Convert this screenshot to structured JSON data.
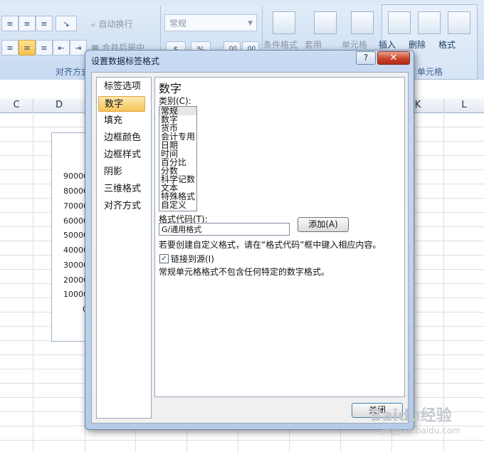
{
  "ribbon": {
    "wrap_text": "自动换行",
    "merge_center": "合并后居中",
    "number_format": "常规",
    "alignment_group": "对齐方式",
    "conditional_format": "条件格式",
    "table_format": "套用",
    "cell_styles": "单元格",
    "insert": "插入",
    "delete": "删除",
    "format": "格式",
    "cells_group": "单元格",
    "number_symbols": [
      "%",
      ".00",
      ".00"
    ]
  },
  "sheet": {
    "columns": [
      "C",
      "D",
      "K",
      "L"
    ],
    "axis_labels": [
      "90000",
      "80000",
      "70000",
      "60000",
      "50000",
      "40000",
      "30000",
      "20000",
      "10000",
      "0"
    ]
  },
  "dialog": {
    "title": "设置数据标签格式",
    "help_symbol": "?",
    "close_symbol": "✕",
    "nav": [
      "标签选项",
      "数字",
      "填充",
      "边框颜色",
      "边框样式",
      "阴影",
      "三维格式",
      "对齐方式"
    ],
    "selected_nav": "数字",
    "panel_title": "数字",
    "category_label": "类别(C):",
    "categories": [
      "常规",
      "数字",
      "货币",
      "会计专用",
      "日期",
      "时间",
      "百分比",
      "分数",
      "科学记数",
      "文本",
      "特殊格式",
      "自定义"
    ],
    "selected_category": "常规",
    "format_code_label": "格式代码(T):",
    "format_code_value": "G/通用格式",
    "add_button": "添加(A)",
    "hint_text": "若要创建自定义格式，请在“格式代码”框中键入相应内容。",
    "link_source_label": "链接到源(I)",
    "link_source_checked": true,
    "check_mark": "✓",
    "description": "常规单元格格式不包含任何特定的数字格式。",
    "close_button": "关闭"
  },
  "watermark": {
    "main": "Baidu经验",
    "sub": "jingyan.baidu.com"
  }
}
